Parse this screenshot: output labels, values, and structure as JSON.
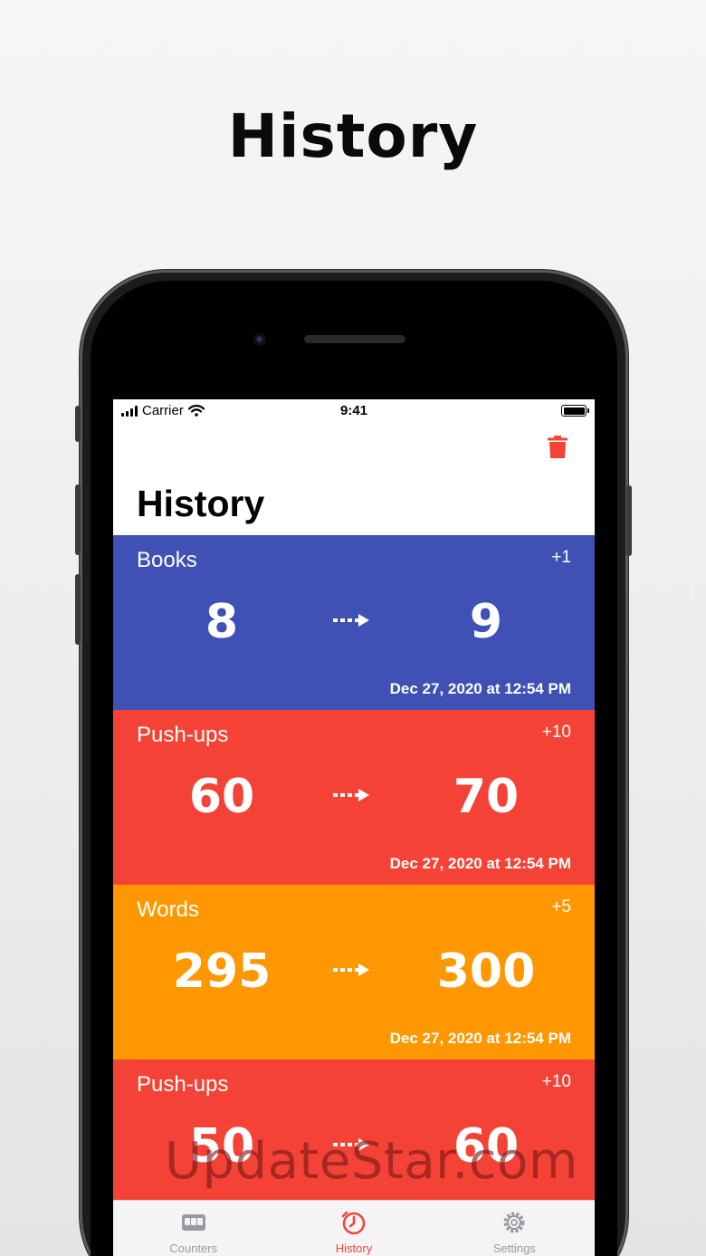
{
  "promo": {
    "title": "History"
  },
  "status_bar": {
    "carrier": "Carrier",
    "time": "9:41"
  },
  "nav": {
    "title": "History",
    "trash_icon": "trash-icon"
  },
  "colors": {
    "blue": "#3f51b5",
    "red": "#f44336",
    "orange": "#ff9800",
    "accent": "#f44236"
  },
  "history": [
    {
      "name": "Books",
      "delta": "+1",
      "from": "8",
      "to": "9",
      "date": "Dec 27, 2020 at 12:54 PM",
      "color": "#3f51b5"
    },
    {
      "name": "Push-ups",
      "delta": "+10",
      "from": "60",
      "to": "70",
      "date": "Dec 27, 2020 at 12:54 PM",
      "color": "#f44336"
    },
    {
      "name": "Words",
      "delta": "+5",
      "from": "295",
      "to": "300",
      "date": "Dec 27, 2020 at 12:54 PM",
      "color": "#ff9800"
    },
    {
      "name": "Push-ups",
      "delta": "+10",
      "from": "50",
      "to": "60",
      "date": "",
      "color": "#f44336"
    }
  ],
  "tabs": [
    {
      "label": "Counters",
      "icon": "counter-icon",
      "active": false
    },
    {
      "label": "History",
      "icon": "clock-icon",
      "active": true
    },
    {
      "label": "Settings",
      "icon": "gear-icon",
      "active": false
    }
  ],
  "watermark": {
    "text": "UpdateStar.com"
  }
}
